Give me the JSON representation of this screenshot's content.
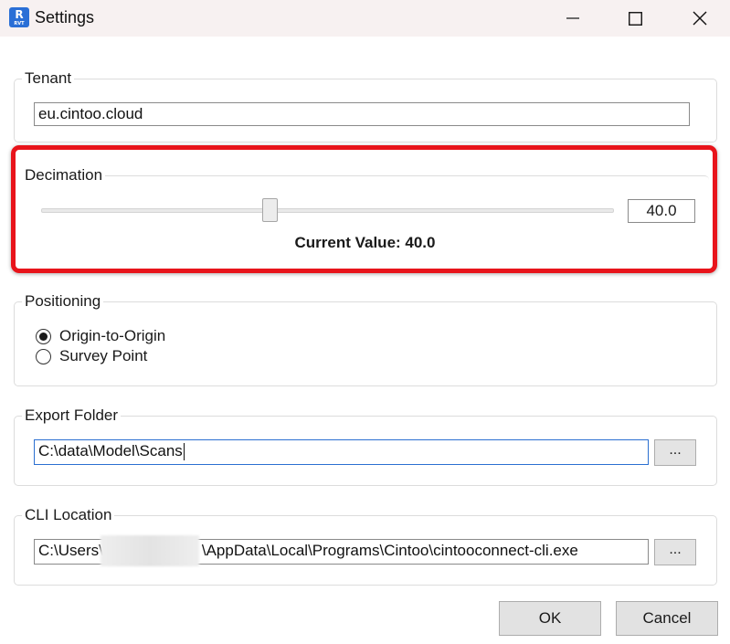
{
  "window": {
    "title": "Settings",
    "app_icon_letter": "R",
    "app_icon_sub": "RVT",
    "minimize_icon": "minimize-icon",
    "maximize_icon": "maximize-icon",
    "close_icon": "close-icon"
  },
  "tenant": {
    "label": "Tenant",
    "value": "eu.cintoo.cloud"
  },
  "decimation": {
    "label": "Decimation",
    "slider_value": 40.0,
    "slider_max": 100,
    "value_text": "40.0",
    "current_value_text": "Current Value: 40.0",
    "highlight_color": "#e8141b"
  },
  "positioning": {
    "label": "Positioning",
    "options": [
      {
        "label": "Origin-to-Origin",
        "checked": true
      },
      {
        "label": "Survey Point",
        "checked": false
      }
    ]
  },
  "export_folder": {
    "label": "Export Folder",
    "value": "C:\\data\\Model\\Scans",
    "browse_label": "..."
  },
  "cli_location": {
    "label": "CLI Location",
    "value_prefix": "C:\\Users\\",
    "value_suffix": "\\AppData\\Local\\Programs\\Cintoo\\cintooconnect-cli.exe",
    "browse_label": "..."
  },
  "buttons": {
    "ok": "OK",
    "cancel": "Cancel"
  },
  "colors": {
    "titlebar_bg": "#f7f1f1",
    "focus_border": "#2b6fd1"
  }
}
